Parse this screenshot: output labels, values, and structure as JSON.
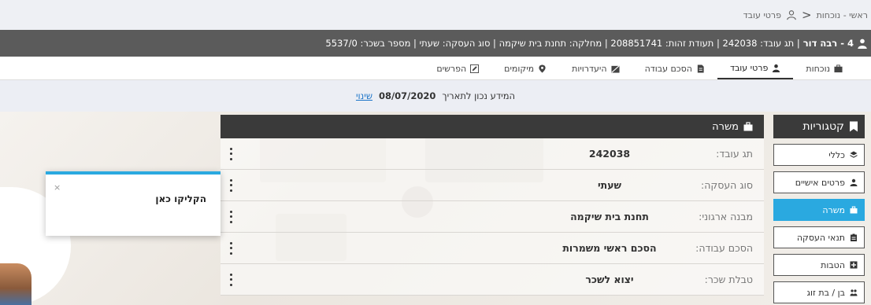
{
  "breadcrumb": {
    "home": "ראשי - נוכחות",
    "separator": "<",
    "current": "פרטי עובד"
  },
  "employee": {
    "name": "4 - רבה דור",
    "details": "| תג עובד: 242038 | תעודת זהות: 208851741 | מחלקה: תחנת בית שיקמה | סוג העסקה: שעתי | מספר בשכר: 5537/0"
  },
  "tabs": [
    {
      "label": "נוכחות",
      "icon": "briefcase-icon"
    },
    {
      "label": "פרטי עובד",
      "icon": "person-icon",
      "active": true
    },
    {
      "label": "הסכם עבודה",
      "icon": "document-icon"
    },
    {
      "label": "היעדרויות",
      "icon": "absence-icon"
    },
    {
      "label": "מיקומים",
      "icon": "location-pin-icon"
    },
    {
      "label": "הפרשים",
      "icon": "edit-icon"
    }
  ],
  "info": {
    "prefix": "המידע נכון לתאריך",
    "date": "08/07/2020",
    "change": "שינוי"
  },
  "categories": {
    "title": "קטגוריות",
    "items": [
      {
        "label": "כללי",
        "icon": "layers-icon"
      },
      {
        "label": "פרטים אישיים",
        "icon": "person-icon"
      },
      {
        "label": "משרה",
        "icon": "briefcase-icon",
        "active": true
      },
      {
        "label": "תנאי העסקה",
        "icon": "clipboard-icon"
      },
      {
        "label": "הטבות",
        "icon": "gift-icon"
      },
      {
        "label": "בן / בת זוג",
        "icon": "couple-icon"
      }
    ]
  },
  "job": {
    "title": "משרה",
    "rows": [
      {
        "label": "תג עובד:",
        "value": "242038"
      },
      {
        "label": "סוג העסקה:",
        "value": "שעתי"
      },
      {
        "label": "מבנה ארגוני:",
        "value": "תחנת בית שיקמה"
      },
      {
        "label": "הסכם עבודה:",
        "value": "הסכם ראשי משמרות"
      },
      {
        "label": "טבלת שכר:",
        "value": "יצוא לשכר"
      }
    ]
  },
  "popup": {
    "text": "הקליקו כאן",
    "close": "×"
  },
  "colors": {
    "accent": "#2aa9e0",
    "header_dark": "#3a3a3a",
    "employee_bar": "#5b5b5b"
  }
}
